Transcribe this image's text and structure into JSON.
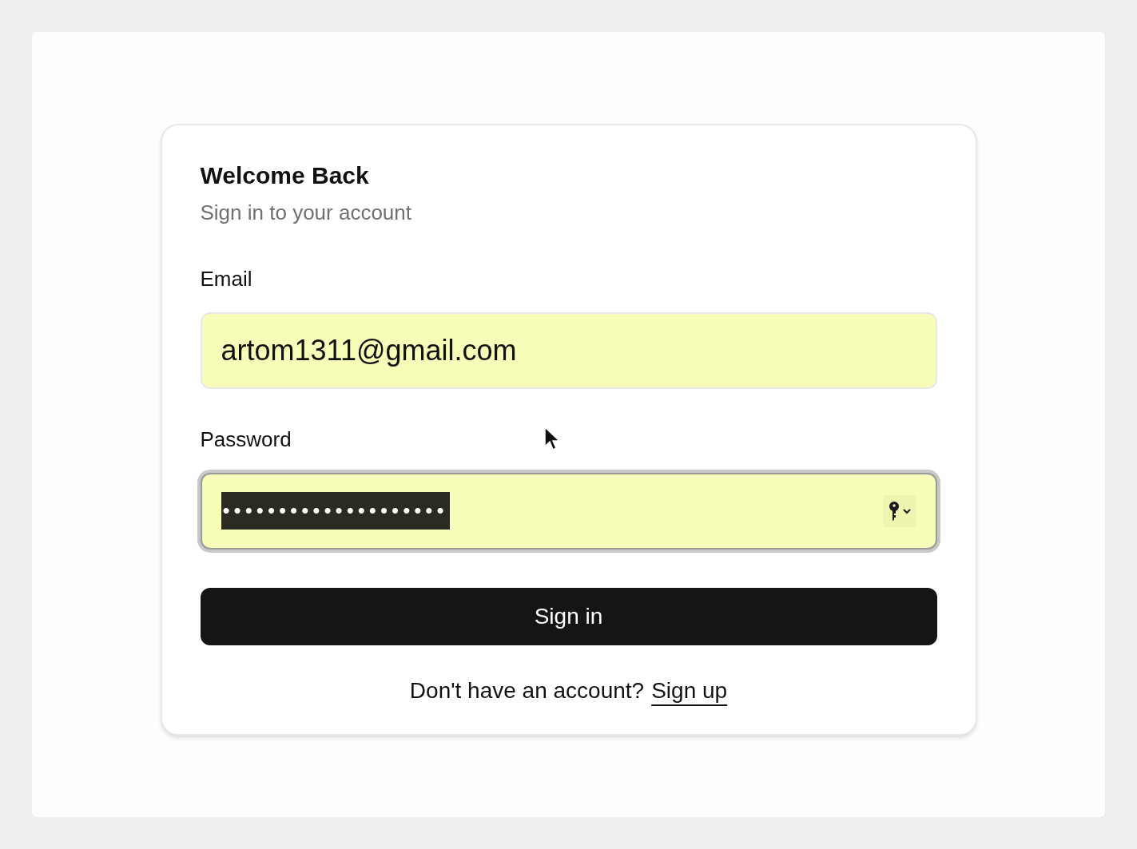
{
  "card": {
    "title": "Welcome Back",
    "subtitle": "Sign in to your account"
  },
  "fields": [
    {
      "label": "Email",
      "value": "artom1311@gmail.com",
      "autofilled": true,
      "focused": false,
      "masked": false,
      "text_highlighted": false,
      "key_menu": false
    },
    {
      "label": "Password",
      "value": "••••••••••••••••••••",
      "autofilled": true,
      "focused": true,
      "masked": true,
      "text_highlighted": true,
      "key_menu": true
    }
  ],
  "submit_button": "Sign in",
  "footer": {
    "prompt": "Don't have an account?",
    "link": "Sign up"
  }
}
